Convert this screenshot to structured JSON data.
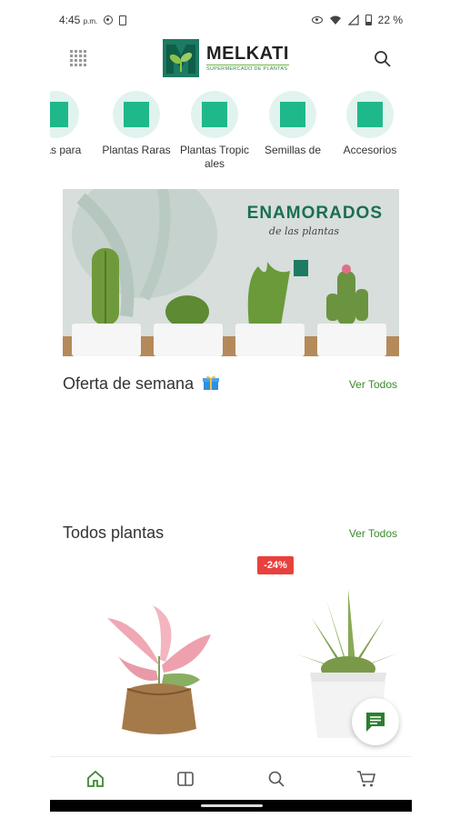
{
  "status_bar": {
    "time": "4:45",
    "ampm": "p.m.",
    "battery": "22 %"
  },
  "header": {
    "brand_name": "MELKATI",
    "brand_subtitle": "SUPERMERCADO DE PLANTAS"
  },
  "categories": [
    {
      "label": "antas para"
    },
    {
      "label": "Plantas Raras"
    },
    {
      "label": "Plantas Tropicales"
    },
    {
      "label": "Semillas de"
    },
    {
      "label": "Accesorios"
    }
  ],
  "banner": {
    "title": "ENAMORADOS",
    "subtitle": "de las plantas"
  },
  "weekly_offer": {
    "title": "Oferta de semana",
    "see_all": "Ver Todos"
  },
  "all_plants": {
    "title": "Todos plantas",
    "see_all": "Ver Todos"
  },
  "products": [
    {
      "discount": ""
    },
    {
      "discount": "-24%"
    }
  ],
  "colors": {
    "brand_green": "#1d7a63",
    "category_bg": "#e1f3ee",
    "category_square": "#1fb88a",
    "link_green": "#3a8a2a",
    "discount_red": "#e8413d"
  },
  "icons": {
    "menu": "grid-menu-icon",
    "search": "search-icon",
    "gift": "gift-icon",
    "chat": "chat-icon",
    "home": "home-icon",
    "catalog": "book-icon",
    "nav_search": "search-icon",
    "cart": "cart-icon"
  }
}
